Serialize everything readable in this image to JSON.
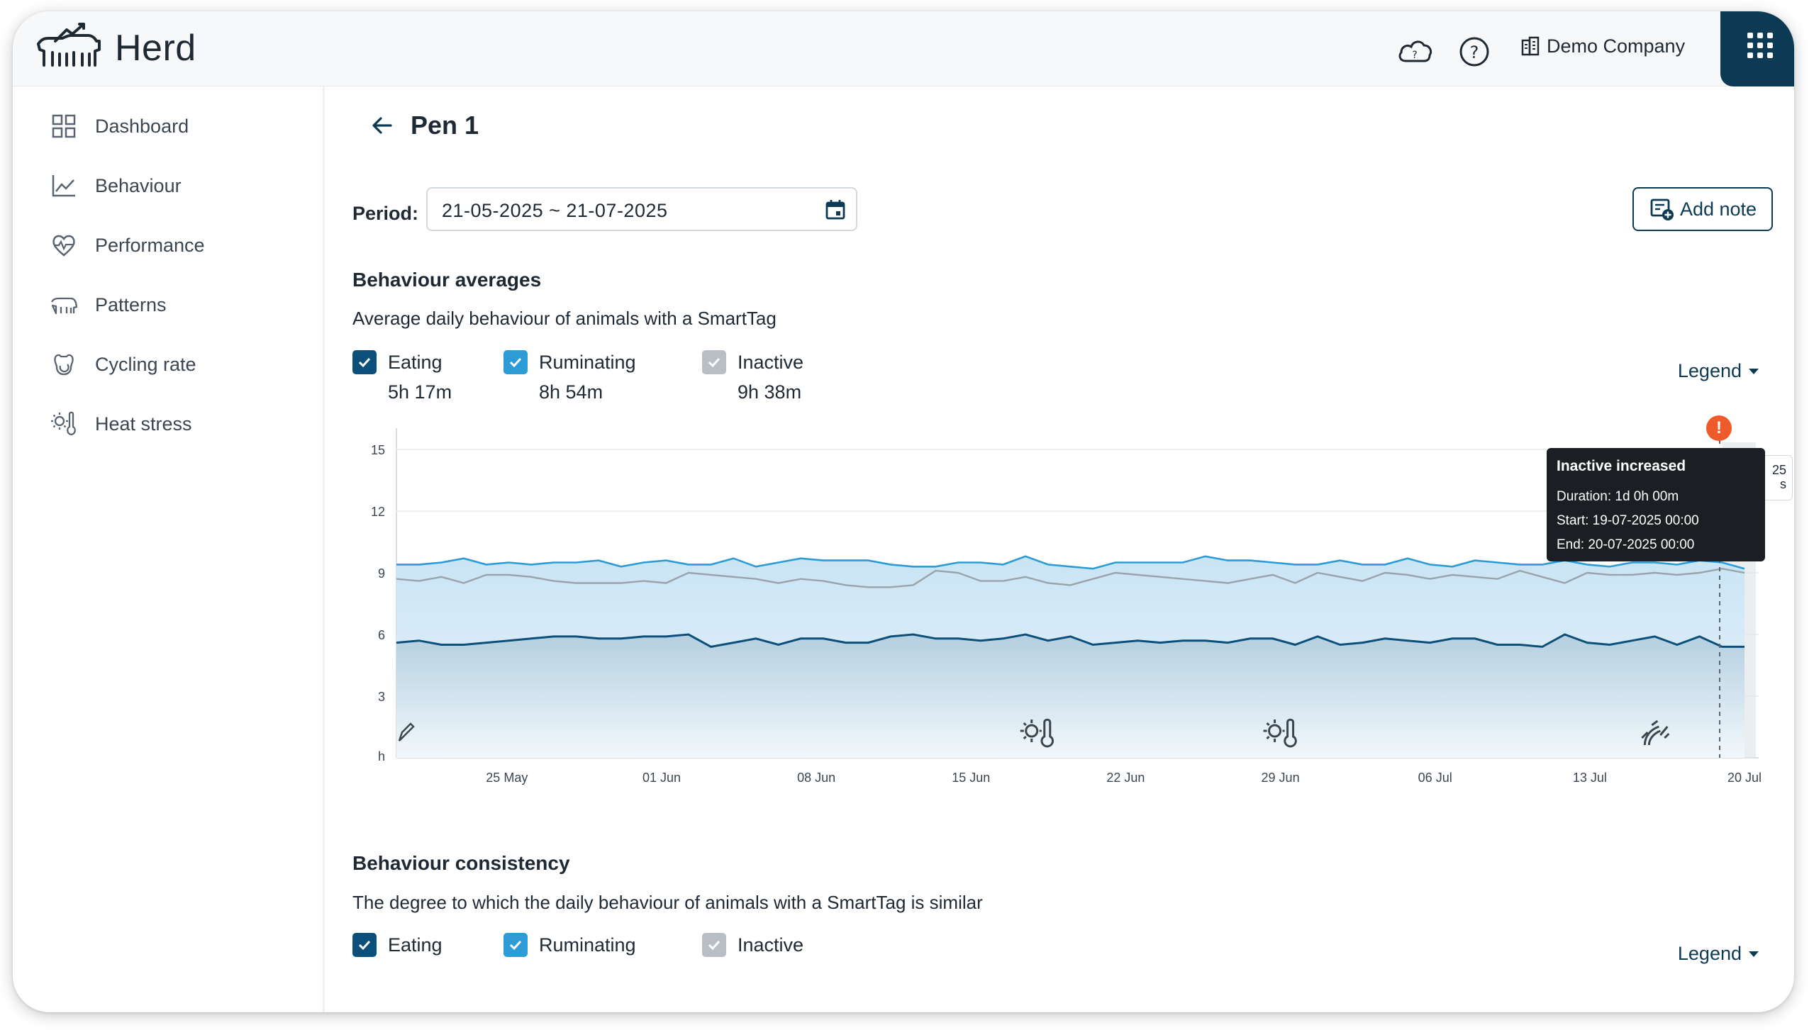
{
  "app": {
    "name": "Herd",
    "company": "Demo Company",
    "icons": {
      "cloud": "cloud-sync-icon",
      "help": "help-icon",
      "company": "building-icon",
      "apps": "apps-grid-icon"
    }
  },
  "sidebar": {
    "items": [
      {
        "label": "Dashboard",
        "icon": "dashboard-icon"
      },
      {
        "label": "Behaviour",
        "icon": "line-chart-icon"
      },
      {
        "label": "Performance",
        "icon": "heart-pulse-icon"
      },
      {
        "label": "Patterns",
        "icon": "cow-pattern-icon"
      },
      {
        "label": "Cycling rate",
        "icon": "cycle-icon"
      },
      {
        "label": "Heat stress",
        "icon": "heat-stress-icon"
      }
    ]
  },
  "page": {
    "title": "Pen 1",
    "period_label": "Period:",
    "period_value": "21-05-2025 ~ 21-07-2025",
    "add_note_label": "Add note"
  },
  "averages": {
    "title": "Behaviour averages",
    "description": "Average daily behaviour of animals with a SmartTag",
    "legend_label": "Legend",
    "checkboxes": [
      {
        "label": "Eating",
        "value": "5h 17m",
        "checked": true,
        "color": "#0c4f7a"
      },
      {
        "label": "Ruminating",
        "value": "8h 54m",
        "checked": true,
        "color": "#2c9bd6"
      },
      {
        "label": "Inactive",
        "value": "9h 38m",
        "checked": true,
        "color": "#b8bec4"
      }
    ]
  },
  "tooltip": {
    "title": "Inactive increased",
    "duration": "Duration: 1d 0h 00m",
    "start": "Start: 19-07-2025 00:00",
    "end": "End: 20-07-2025 00:00",
    "alert_symbol": "!",
    "alert_color": "#ee5a2a",
    "behind_text": [
      "25",
      "s"
    ]
  },
  "chart_data": {
    "type": "area",
    "ylabel": "h",
    "ylim": [
      0,
      15
    ],
    "yticks": [
      15,
      12,
      9,
      6,
      3
    ],
    "xticks": [
      "25 May",
      "01 Jun",
      "08 Jun",
      "15 Jun",
      "22 Jun",
      "29 Jun",
      "06 Jul",
      "13 Jul",
      "20 Jul"
    ],
    "x_start": "2025-05-20",
    "x_end": "2025-07-20",
    "series": [
      {
        "color": "#2c9bd6",
        "values": [
          9.4,
          9.4,
          9.5,
          9.7,
          9.4,
          9.5,
          9.4,
          9.5,
          9.5,
          9.6,
          9.3,
          9.5,
          9.6,
          9.4,
          9.4,
          9.7,
          9.3,
          9.5,
          9.7,
          9.6,
          9.6,
          9.6,
          9.4,
          9.3,
          9.3,
          9.5,
          9.5,
          9.4,
          9.8,
          9.4,
          9.3,
          9.2,
          9.5,
          9.5,
          9.5,
          9.5,
          9.8,
          9.6,
          9.6,
          9.5,
          9.4,
          9.4,
          9.6,
          9.4,
          9.4,
          9.7,
          9.4,
          9.3,
          9.6,
          9.5,
          9.4,
          9.4,
          9.6,
          9.4,
          9.3,
          9.5,
          9.5,
          9.4,
          9.6,
          9.5,
          9.2
        ]
      },
      {
        "color": "#9aa3aa",
        "values": [
          8.7,
          8.6,
          8.8,
          8.5,
          8.9,
          8.9,
          8.8,
          8.6,
          8.5,
          8.5,
          8.5,
          8.6,
          8.5,
          9.0,
          8.9,
          8.8,
          8.7,
          8.5,
          8.7,
          8.6,
          8.4,
          8.3,
          8.3,
          8.4,
          9.1,
          9.0,
          8.6,
          8.6,
          8.8,
          8.5,
          8.4,
          8.7,
          9.0,
          8.9,
          8.8,
          8.7,
          8.6,
          8.5,
          8.7,
          8.9,
          8.5,
          9.0,
          8.8,
          8.6,
          9.0,
          8.9,
          8.7,
          8.9,
          8.8,
          8.7,
          9.1,
          8.8,
          8.5,
          9.0,
          8.9,
          8.9,
          9.0,
          8.9,
          9.0,
          9.2,
          9.0
        ]
      },
      {
        "color": "#0c4f7a",
        "values": [
          5.6,
          5.7,
          5.5,
          5.5,
          5.6,
          5.7,
          5.8,
          5.9,
          5.9,
          5.8,
          5.8,
          5.9,
          5.9,
          6.0,
          5.4,
          5.6,
          5.8,
          5.5,
          5.8,
          5.8,
          5.6,
          5.6,
          5.9,
          6.0,
          5.8,
          5.8,
          5.7,
          5.8,
          6.0,
          5.7,
          5.9,
          5.5,
          5.6,
          5.7,
          5.6,
          5.7,
          5.7,
          5.6,
          5.8,
          5.8,
          5.5,
          5.9,
          5.5,
          5.6,
          5.8,
          5.7,
          5.6,
          5.8,
          5.8,
          5.5,
          5.5,
          5.4,
          6.0,
          5.6,
          5.5,
          5.7,
          5.9,
          5.5,
          5.9,
          5.4,
          5.4
        ]
      }
    ],
    "events": [
      {
        "icon": "note-pencil-icon",
        "date": "2025-05-20"
      },
      {
        "icon": "heat-stress-icon",
        "date": "2025-06-18"
      },
      {
        "icon": "heat-stress-icon",
        "date": "2025-06-29"
      },
      {
        "icon": "hoof-alert-icon",
        "date": "2025-07-16"
      }
    ]
  },
  "consistency": {
    "title": "Behaviour consistency",
    "description": "The degree to which the daily behaviour of animals with a SmartTag is similar",
    "legend_label": "Legend",
    "checkboxes": [
      {
        "label": "Eating",
        "checked": true,
        "color": "#0c4f7a"
      },
      {
        "label": "Ruminating",
        "checked": true,
        "color": "#2c9bd6"
      },
      {
        "label": "Inactive",
        "checked": true,
        "color": "#b8bec4"
      }
    ]
  }
}
